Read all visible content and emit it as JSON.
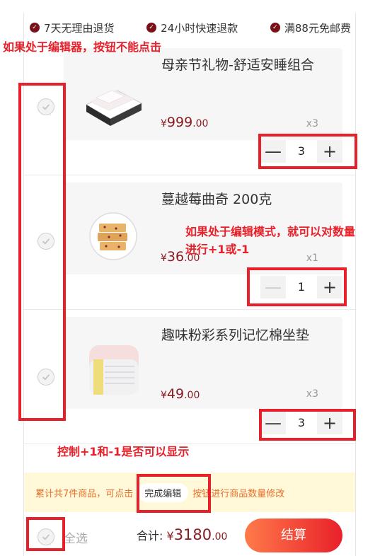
{
  "topbar": {
    "promises": [
      {
        "label": "7天无理由退货"
      },
      {
        "label": "24小时快速退款"
      },
      {
        "label": "满88元免邮费"
      }
    ]
  },
  "annotations": {
    "editor_disabled": "如果处于编辑器，按钮不能点击",
    "edit_mode_line1": "如果处于编辑模式，就可以对数量",
    "edit_mode_line2": "进行+1或-1",
    "control_display": "控制+1和-1是否可以显示"
  },
  "items": [
    {
      "title": "母亲节礼物-舒适安睡组合",
      "currency": "¥",
      "price_int": "999",
      "price_dec": ".00",
      "qty_label": "x3",
      "quantity": "3",
      "minus": "—",
      "plus": "+",
      "minus_enabled": true
    },
    {
      "title": "蔓越莓曲奇 200克",
      "currency": "¥",
      "price_int": "36",
      "price_dec": ".00",
      "qty_label": "x1",
      "quantity": "1",
      "minus": "—",
      "plus": "+",
      "minus_enabled": false
    },
    {
      "title": "趣味粉彩系列记忆棉坐垫",
      "currency": "¥",
      "price_int": "49",
      "price_dec": ".00",
      "qty_label": "x3",
      "quantity": "3",
      "minus": "—",
      "plus": "+",
      "minus_enabled": true
    }
  ],
  "notice": {
    "before": "累计共7件商品，可点击",
    "button": "完成编辑",
    "after": "按钮进行商品数量修改"
  },
  "footer": {
    "select_all": "全选",
    "total_label": "合计:",
    "currency": "¥",
    "total_int": "3180",
    "total_dec": ".00",
    "checkout": "结算"
  },
  "colors": {
    "accent": "#e8202a",
    "price": "#8a1b22",
    "notice_bg": "#fff8d9",
    "notice_text": "#e86f2a"
  }
}
